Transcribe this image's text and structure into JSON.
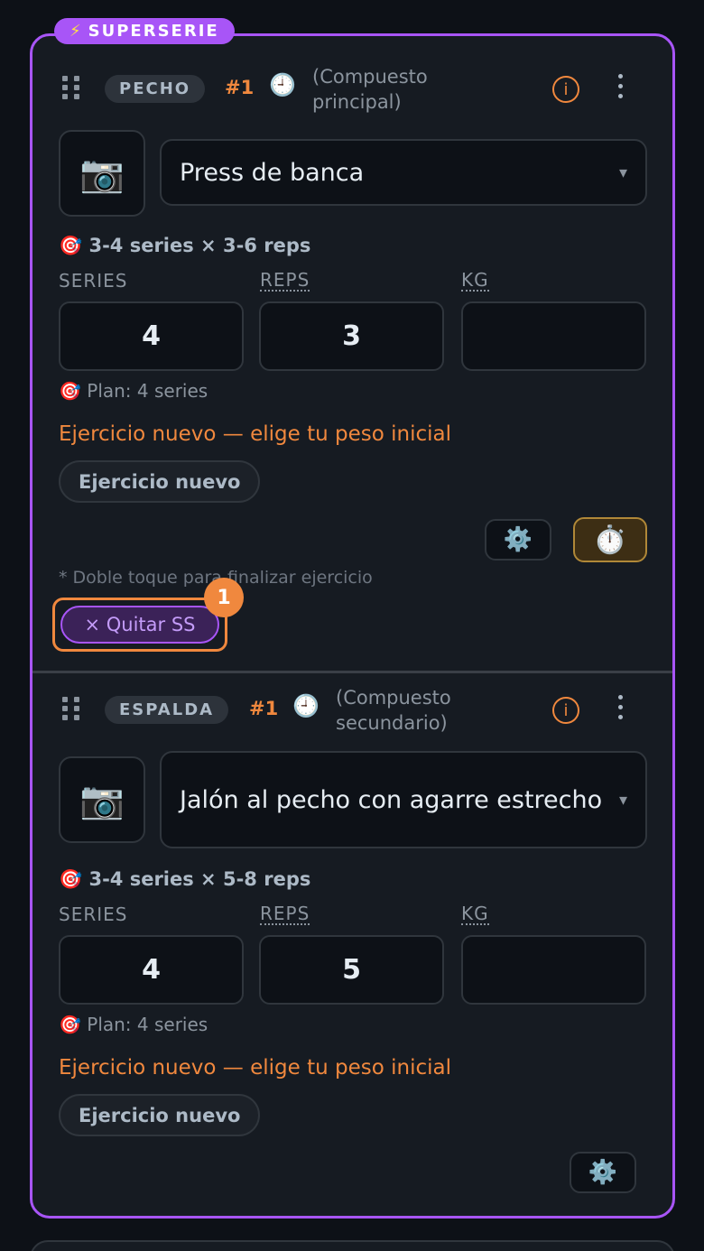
{
  "superset": {
    "badge_icon": "⚡",
    "badge_label": "SUPERSERIE",
    "accent": "#a855f7"
  },
  "exercises": [
    {
      "group": "PECHO",
      "rank": "#1",
      "type_icon": "🕘",
      "type_line1": "(Compuesto",
      "type_line2": "principal)",
      "info_icon": "i",
      "photo_icon": "📷",
      "name": "Press de banca",
      "caret": "▾",
      "target": "🎯 3-4 series × 3-6 reps",
      "labels": {
        "series": "SERIES",
        "reps": "REPS",
        "kg": "KG"
      },
      "values": {
        "series": "4",
        "reps": "3",
        "kg": ""
      },
      "plan": "🎯 Plan: 4 series",
      "warning": "Ejercicio nuevo — elige tu peso inicial",
      "new_label": "Ejercicio nuevo",
      "settings_icon": "⚙️",
      "timer_icon": "⏱️",
      "hint": "* Doble toque para finalizar ejercicio",
      "remove_label": "× Quitar SS",
      "step_number": "1"
    },
    {
      "group": "ESPALDA",
      "rank": "#1",
      "type_icon": "🕘",
      "type_line1": "(Compuesto",
      "type_line2": "secundario)",
      "info_icon": "i",
      "photo_icon": "📷",
      "name": "Jalón al pecho con agarre estrecho",
      "caret": "▾",
      "target": "🎯 3-4 series × 5-8 reps",
      "labels": {
        "series": "SERIES",
        "reps": "REPS",
        "kg": "KG"
      },
      "values": {
        "series": "4",
        "reps": "5",
        "kg": ""
      },
      "plan": "🎯 Plan: 4 series",
      "warning": "Ejercicio nuevo — elige tu peso inicial",
      "new_label": "Ejercicio nuevo",
      "settings_icon": "⚙️"
    }
  ]
}
